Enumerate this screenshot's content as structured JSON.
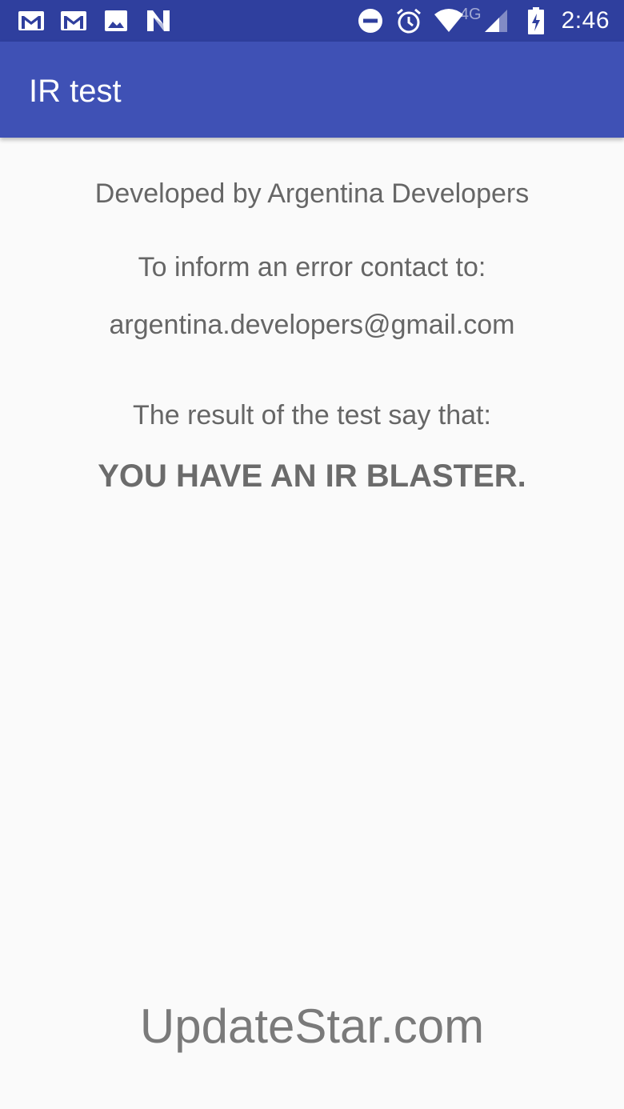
{
  "status_bar": {
    "left_icons": [
      "gmail-icon",
      "gmail-icon",
      "gallery-image-icon",
      "n-app-icon"
    ],
    "right_icons": [
      "do-not-disturb-icon",
      "alarm-icon",
      "wifi-icon",
      "signal-icon",
      "battery-charging-icon"
    ],
    "network_type": "4G",
    "time": "2:46"
  },
  "app_bar": {
    "title": "IR test",
    "color": "#3f51b5"
  },
  "content": {
    "developer_line": "Developed by Argentina Developers",
    "contact_line": "To inform an error contact to:",
    "email": "argentina.developers@gmail.com",
    "result_intro": "The result of the test say that:",
    "result": "YOU HAVE AN IR BLASTER."
  },
  "watermark": "UpdateStar.com"
}
